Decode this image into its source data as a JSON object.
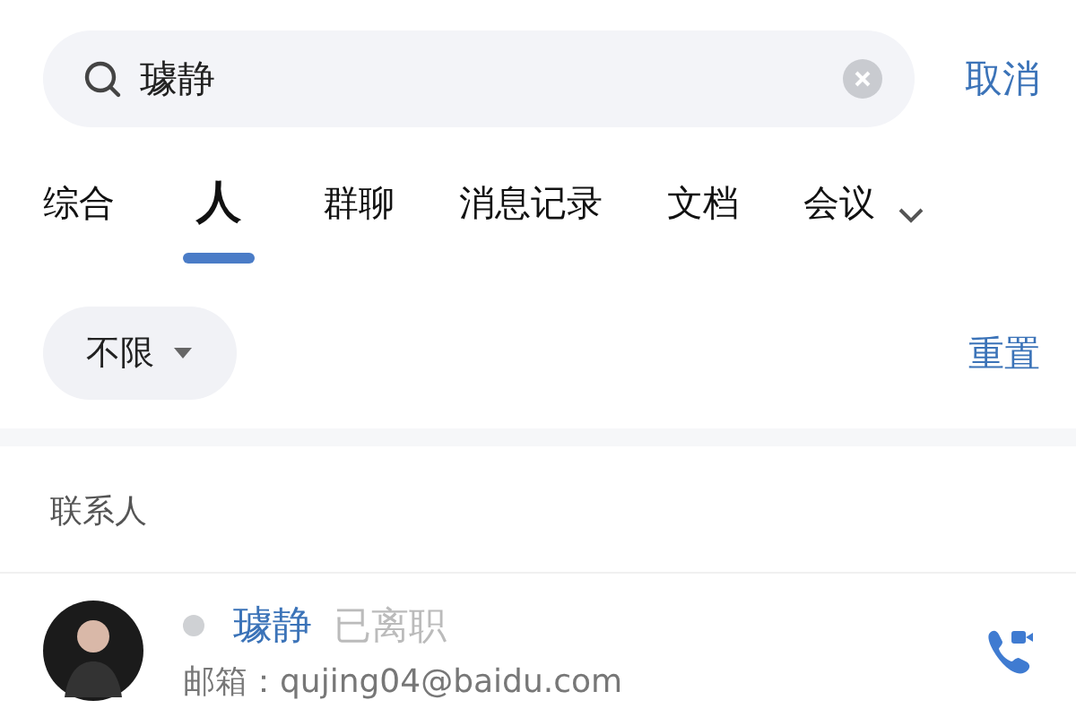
{
  "search": {
    "value": "璩静",
    "cancel": "取消"
  },
  "tabs": [
    {
      "label": "综合",
      "selected": false
    },
    {
      "label": "人",
      "selected": true
    },
    {
      "label": "群聊",
      "selected": false
    },
    {
      "label": "消息记录",
      "selected": false
    },
    {
      "label": "文档",
      "selected": false
    },
    {
      "label": "会议",
      "selected": false
    }
  ],
  "filter": {
    "label": "不限",
    "reset": "重置"
  },
  "section": {
    "title": "联系人"
  },
  "contacts": [
    {
      "name": "璩静",
      "online": false,
      "status": "已离职",
      "email": "邮箱：qujing04@baidu.com"
    }
  ]
}
